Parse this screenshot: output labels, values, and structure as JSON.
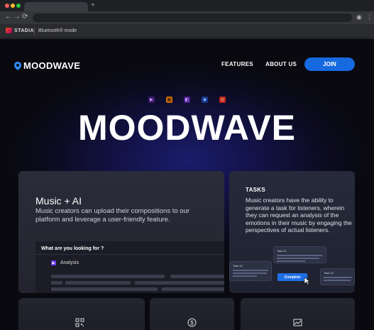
{
  "browser": {
    "new_tab_symbol": "+",
    "back_icon": "←",
    "forward_icon": "→",
    "reload_icon": "⟳",
    "profile_icon": "◉",
    "menu_icon": "⋮",
    "bookmarks": {
      "stadia_label": "STADIA",
      "mode_label": "Bluetooth® mode"
    }
  },
  "header": {
    "logo_text": "MOODWAVE",
    "nav": {
      "features": "FEATURES",
      "about": "ABOUT US",
      "join": "JOIN"
    }
  },
  "hero": {
    "title": "MOODWAVE",
    "app_icons": [
      "premiere-icon",
      "illustrator-icon",
      "aftereffects-icon",
      "photoshop-icon",
      "acrobat-icon"
    ]
  },
  "main_card": {
    "heading": "Music + AI",
    "body": "Music creators can upload their compositions to our platform and leverage a user-friendly feature.",
    "search_prompt": "What are you looking for ?",
    "analysis_label": "Analysis"
  },
  "tasks_card": {
    "heading": "TASKS",
    "body": "Music creators have the ability to generate a task for listeners, wherein they can request an analysis of the emotions in their music by engaging the perspectives of actual listeners.",
    "mini_tasks": [
      "Task 01",
      "Task 02",
      "Task 03"
    ],
    "complete_label": "Complete"
  },
  "bottom_cards": {
    "icons": [
      "qr-scan-icon",
      "dollar-icon",
      "image-chart-icon"
    ]
  },
  "colors": {
    "accent": "#1769e0",
    "background": "#0b0b12"
  }
}
